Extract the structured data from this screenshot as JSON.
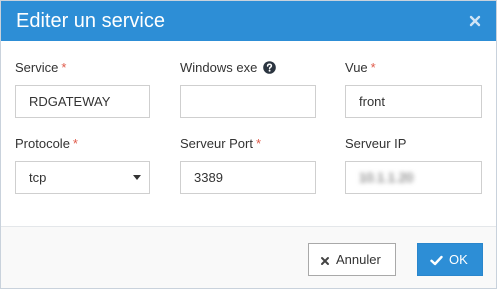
{
  "dialog": {
    "title": "Editer un service",
    "close_icon": "close-x-icon"
  },
  "fields": {
    "service": {
      "label": "Service",
      "required": "*",
      "value": "RDGATEWAY"
    },
    "windows_exe": {
      "label": "Windows exe",
      "help_icon": "question-circle-icon",
      "value": ""
    },
    "vue": {
      "label": "Vue",
      "required": "*",
      "value": "front"
    },
    "protocole": {
      "label": "Protocole",
      "required": "*",
      "value": "tcp"
    },
    "serveur_port": {
      "label": "Serveur Port",
      "required": "*",
      "value": "3389"
    },
    "serveur_ip": {
      "label": "Serveur IP",
      "value": "10.1.1.20"
    }
  },
  "footer": {
    "cancel_label": "Annuler",
    "cancel_icon": "times-icon",
    "ok_label": "OK",
    "ok_icon": "check-icon"
  },
  "colors": {
    "header": "#2d8ed6",
    "primary_button": "#2d8ed6",
    "required_marker": "#e05a4a"
  }
}
